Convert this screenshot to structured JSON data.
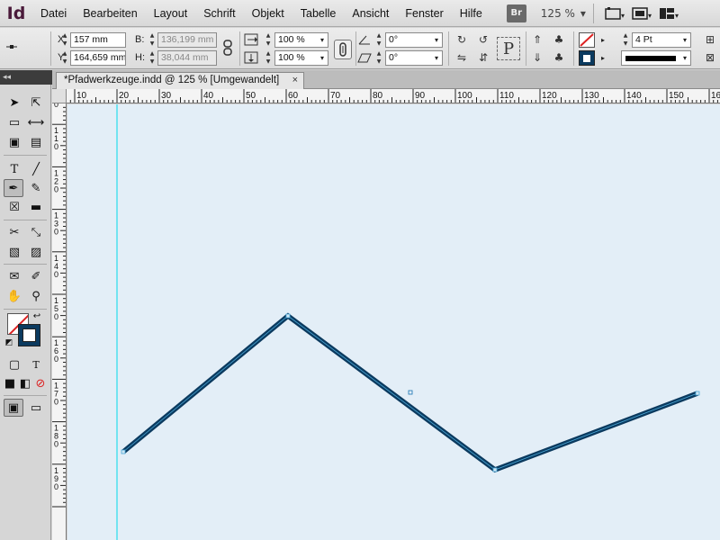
{
  "app": {
    "logo": "Id"
  },
  "menu": [
    "Datei",
    "Bearbeiten",
    "Layout",
    "Schrift",
    "Objekt",
    "Tabelle",
    "Ansicht",
    "Fenster",
    "Hilfe"
  ],
  "bridge_badge": "Br",
  "zoom": "125 %",
  "control": {
    "x_label": "X:",
    "x_value": "157 mm",
    "y_label": "Y:",
    "y_value": "164,659 mm",
    "w_label": "B:",
    "w_value": "136,199 mm",
    "h_label": "H:",
    "h_value": "38,044 mm",
    "scale_x": "100 %",
    "scale_y": "100 %",
    "rotate": "0°",
    "shear": "0°",
    "stroke_weight": "4 Pt"
  },
  "document": {
    "tab_title": "*Pfadwerkzeuge.indd @ 125 % [Umgewandelt]",
    "close": "×"
  },
  "ruler": {
    "h_ticks": [
      "10",
      "20",
      "30",
      "40",
      "50",
      "60",
      "70",
      "80",
      "90",
      "100",
      "110",
      "120",
      "130",
      "140",
      "150",
      "16"
    ],
    "v_ticks": [
      "1\n0\n0",
      "1\n1\n0",
      "1\n2\n0",
      "1\n3\n0",
      "1\n4\n0",
      "1\n5\n0",
      "1\n6\n0",
      "1\n7\n0",
      "1\n8\n0",
      "1\n9\n0"
    ]
  },
  "path": {
    "stroke_color": "#0b3a5f",
    "points_mm": [
      [
        20,
        173
      ],
      [
        60,
        141
      ],
      [
        108,
        179
      ],
      [
        155,
        160
      ]
    ],
    "center_mm": [
      87,
      160
    ]
  },
  "colors": {
    "canvas": "#e3eef7",
    "guide": "#00d8e8",
    "stroke": "#0b3a5f"
  }
}
